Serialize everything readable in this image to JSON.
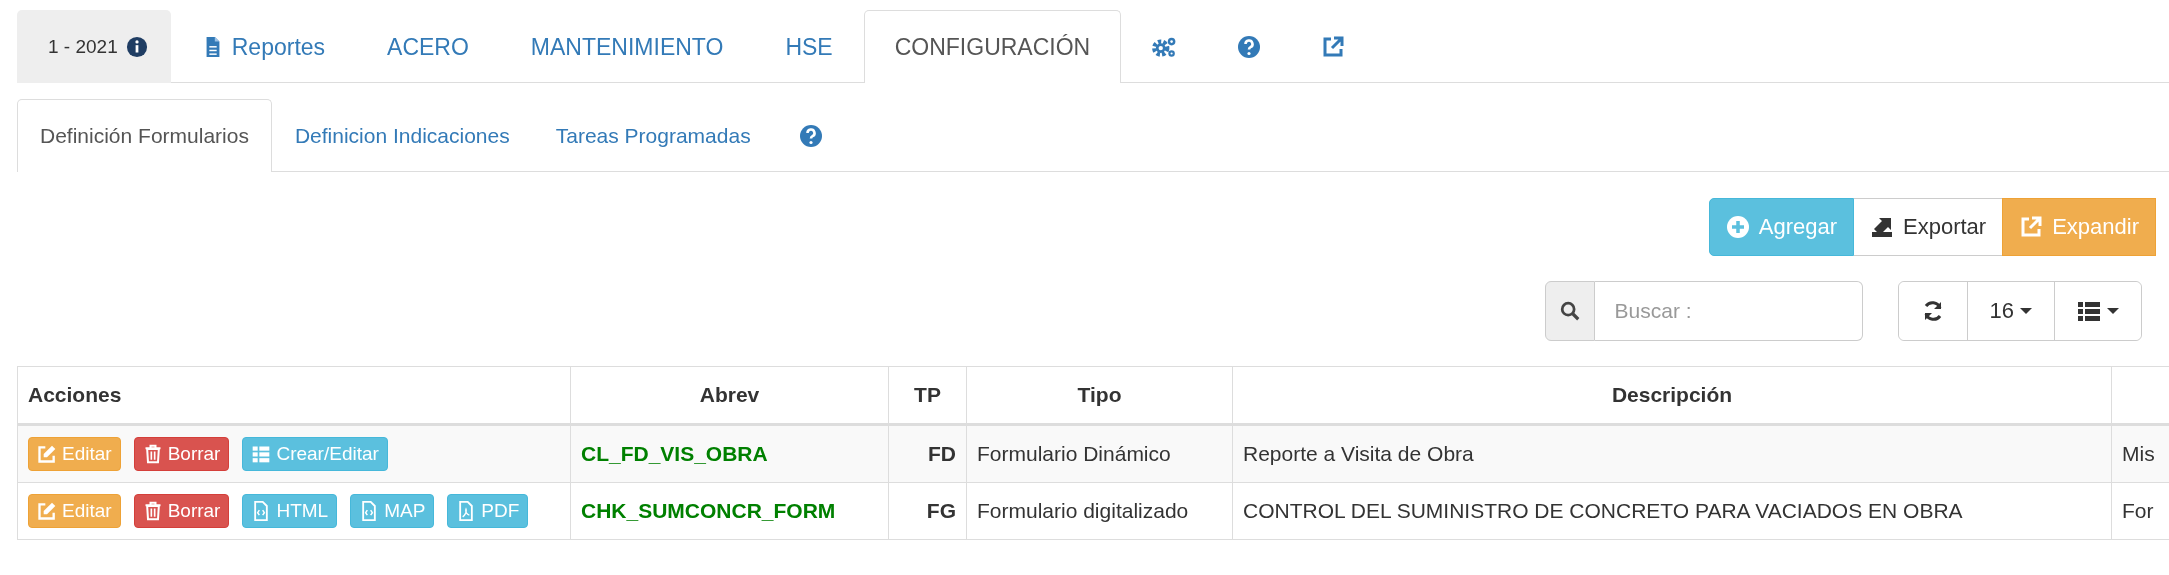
{
  "main_tabs": [
    {
      "kind": "version",
      "label": "1 - 2021",
      "selected": false
    },
    {
      "kind": "report",
      "label": "Reportes",
      "selected": false
    },
    {
      "kind": "text",
      "label": "ACERO",
      "selected": false
    },
    {
      "kind": "text",
      "label": "MANTENIMIENTO",
      "selected": false
    },
    {
      "kind": "text",
      "label": "HSE",
      "selected": false
    },
    {
      "kind": "text",
      "label": "CONFIGURACIÓN",
      "selected": true
    },
    {
      "kind": "gears",
      "selected": false
    },
    {
      "kind": "help",
      "selected": false
    },
    {
      "kind": "external",
      "selected": false
    }
  ],
  "sub_tabs": [
    {
      "kind": "text",
      "label": "Definición Formularios",
      "selected": true
    },
    {
      "kind": "text",
      "label": "Definicion Indicaciones",
      "selected": false
    },
    {
      "kind": "text",
      "label": "Tareas Programadas",
      "selected": false
    },
    {
      "kind": "help",
      "selected": false
    }
  ],
  "toolbar": [
    {
      "kind": "add",
      "label": "Agregar"
    },
    {
      "kind": "export",
      "label": "Exportar"
    },
    {
      "kind": "expand",
      "label": "Expandir"
    }
  ],
  "search": {
    "placeholder": "Buscar :"
  },
  "page_size": "16",
  "table": {
    "columns": [
      "Acciones",
      "Abrev",
      "TP",
      "Tipo",
      "Descripción"
    ],
    "rows": [
      {
        "actions": [
          {
            "kind": "edit",
            "label": "Editar"
          },
          {
            "kind": "delete",
            "label": "Borrar"
          },
          {
            "kind": "grid",
            "label": "Crear/Editar"
          }
        ],
        "abrev": "CL_FD_VIS_OBRA",
        "tp": "FD",
        "tipo": "Formulario Dinámico",
        "descripcion": "Reporte a Visita de Obra",
        "column_6": "Mis"
      },
      {
        "actions": [
          {
            "kind": "edit",
            "label": "Editar"
          },
          {
            "kind": "delete",
            "label": "Borrar"
          },
          {
            "kind": "html",
            "label": "HTML"
          },
          {
            "kind": "map",
            "label": "MAP"
          },
          {
            "kind": "pdf",
            "label": "PDF"
          }
        ],
        "abrev": "CHK_SUMCONCR_FORM",
        "tp": "FG",
        "tipo": "Formulario digitalizado",
        "descripcion": "CONTROL DEL SUMINISTRO DE CONCRETO PARA VACIADOS EN OBRA",
        "column_6": "For"
      }
    ]
  }
}
